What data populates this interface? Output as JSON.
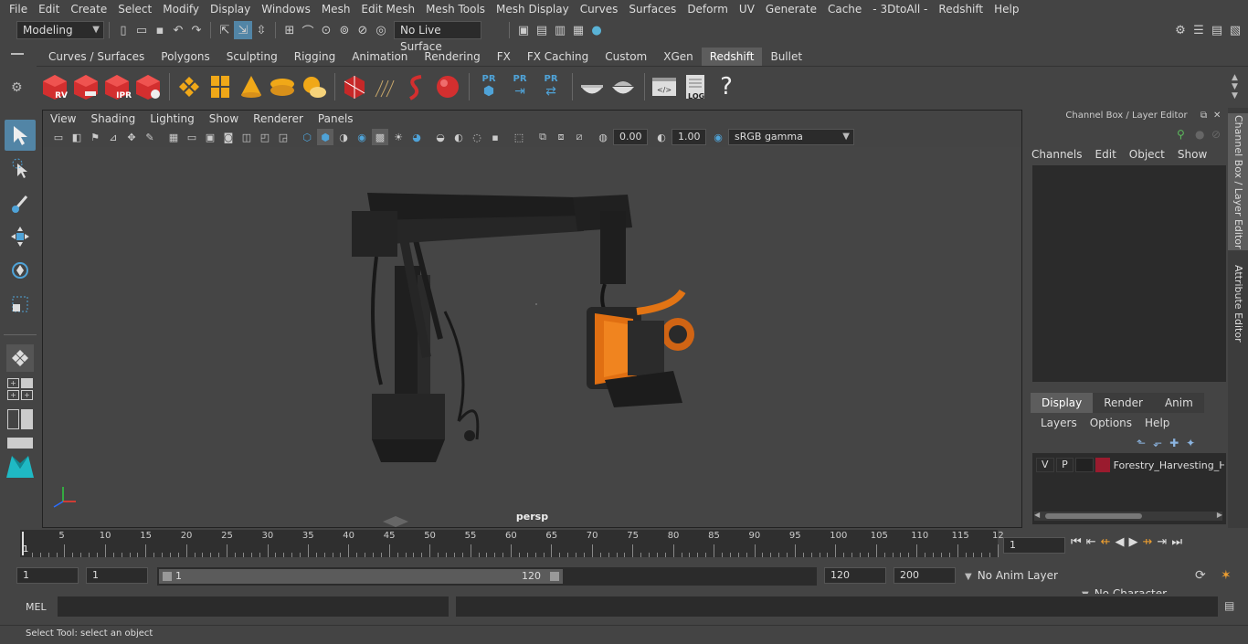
{
  "menubar": [
    "File",
    "Edit",
    "Create",
    "Select",
    "Modify",
    "Display",
    "Windows",
    "Mesh",
    "Edit Mesh",
    "Mesh Tools",
    "Mesh Display",
    "Curves",
    "Surfaces",
    "Deform",
    "UV",
    "Generate",
    "Cache",
    "- 3DtoAll -",
    "Redshift",
    "Help"
  ],
  "status": {
    "mode": "Modeling",
    "live_surface": "No Live Surface"
  },
  "shelf_tabs": [
    {
      "label": "Curves / Surfaces",
      "active": false
    },
    {
      "label": "Polygons",
      "active": false
    },
    {
      "label": "Sculpting",
      "active": false
    },
    {
      "label": "Rigging",
      "active": false
    },
    {
      "label": "Animation",
      "active": false
    },
    {
      "label": "Rendering",
      "active": false
    },
    {
      "label": "FX",
      "active": false
    },
    {
      "label": "FX Caching",
      "active": false
    },
    {
      "label": "Custom",
      "active": false
    },
    {
      "label": "XGen",
      "active": false
    },
    {
      "label": "Redshift",
      "active": true
    },
    {
      "label": "Bullet",
      "active": false
    }
  ],
  "shelf": {
    "rv": "RV",
    "ipr": "IPR",
    "pr": "PR",
    "log": "LOG",
    "help": "?"
  },
  "viewport": {
    "menu": [
      "View",
      "Shading",
      "Lighting",
      "Show",
      "Renderer",
      "Panels"
    ],
    "exposure": "0.00",
    "gamma": "1.00",
    "colorspace": "sRGB gamma",
    "camera": "persp"
  },
  "channelbox": {
    "title": "Channel Box / Layer Editor",
    "menu": [
      "Channels",
      "Edit",
      "Object",
      "Show"
    ]
  },
  "layereditor": {
    "tabs": [
      {
        "label": "Display",
        "active": true
      },
      {
        "label": "Render",
        "active": false
      },
      {
        "label": "Anim",
        "active": false
      }
    ],
    "menu": [
      "Layers",
      "Options",
      "Help"
    ],
    "layer": {
      "v": "V",
      "p": "P",
      "name": "Forestry_Harvesting_H",
      "color": "#9a1b2e"
    }
  },
  "side_tabs": [
    "Channel Box / Layer Editor",
    "Attribute Editor"
  ],
  "timeline": {
    "ticks": [
      "5",
      "10",
      "15",
      "20",
      "25",
      "30",
      "35",
      "40",
      "45",
      "50",
      "55",
      "60",
      "65",
      "70",
      "75",
      "80",
      "85",
      "90",
      "95",
      "100",
      "105",
      "110",
      "115",
      "12"
    ],
    "first": "1",
    "current_frame": "1"
  },
  "range": {
    "start": "1",
    "playback_start": "1",
    "slider_start": "1",
    "slider_end": "120",
    "playback_end": "120",
    "end": "200",
    "anim_layer": "No Anim Layer",
    "character_set": "No Character Set"
  },
  "cmdline": {
    "label": "MEL"
  },
  "helpline": {
    "text": "Select Tool: select an object"
  }
}
